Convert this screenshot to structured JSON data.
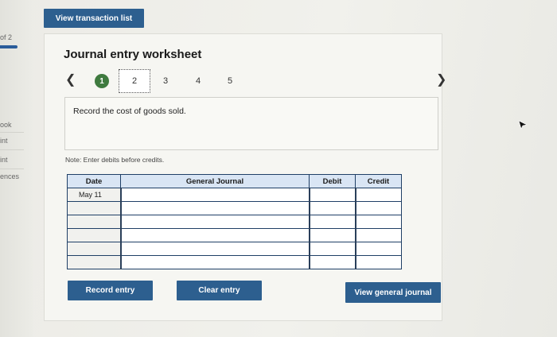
{
  "sidebar": {
    "page_label": "of 2",
    "items": [
      "ook",
      "int",
      "int",
      "ences"
    ]
  },
  "header": {
    "view_transaction_list": "View transaction list"
  },
  "worksheet": {
    "title": "Journal entry worksheet",
    "steps": [
      "1",
      "2",
      "3",
      "4",
      "5"
    ],
    "current_step": "2",
    "completed_step": "1",
    "instruction": "Record the cost of goods sold.",
    "note": "Note: Enter debits before credits."
  },
  "journal_table": {
    "headers": {
      "date": "Date",
      "general_journal": "General Journal",
      "debit": "Debit",
      "credit": "Credit"
    },
    "rows": [
      {
        "date": "May 11",
        "account": "",
        "debit": "",
        "credit": ""
      },
      {
        "date": "",
        "account": "",
        "debit": "",
        "credit": ""
      },
      {
        "date": "",
        "account": "",
        "debit": "",
        "credit": ""
      },
      {
        "date": "",
        "account": "",
        "debit": "",
        "credit": ""
      },
      {
        "date": "",
        "account": "",
        "debit": "",
        "credit": ""
      },
      {
        "date": "",
        "account": "",
        "debit": "",
        "credit": ""
      }
    ]
  },
  "actions": {
    "record_entry": "Record entry",
    "clear_entry": "Clear entry",
    "view_general_journal": "View general journal"
  },
  "colors": {
    "button_bg": "#2d5f8f",
    "header_bg": "#d9e5f4",
    "step_done": "#3f7a3f"
  }
}
